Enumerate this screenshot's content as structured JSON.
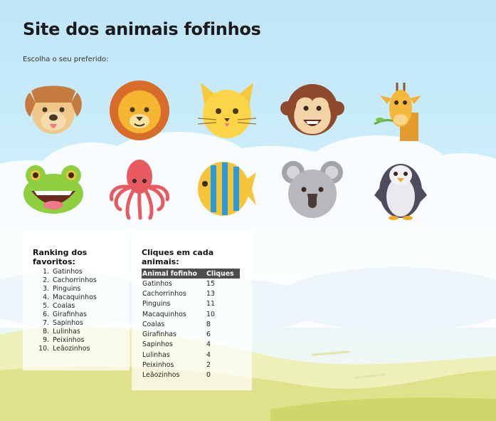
{
  "page": {
    "title": "Site dos animais fofinhos",
    "subtitle": "Escolha o seu preferido:"
  },
  "animals": [
    {
      "name": "dog-icon"
    },
    {
      "name": "lion-icon"
    },
    {
      "name": "cat-icon"
    },
    {
      "name": "monkey-icon"
    },
    {
      "name": "giraffe-icon"
    },
    {
      "name": "frog-icon"
    },
    {
      "name": "octopus-icon"
    },
    {
      "name": "fish-icon"
    },
    {
      "name": "koala-icon"
    },
    {
      "name": "penguin-icon"
    }
  ],
  "ranking": {
    "heading": "Ranking dos favoritos:",
    "items": [
      "Gatinhos",
      "Cachorrinhos",
      "Pinguins",
      "Macaquinhos",
      "Coalas",
      "Girafinhas",
      "Sapinhos",
      "Lulinhas",
      "Peixinhos",
      "Leãozinhos"
    ]
  },
  "clicks": {
    "heading": "Cliques em cada animais:",
    "columns": [
      "Animal fofinho",
      "Cliques"
    ],
    "rows": [
      [
        "Gatinhos",
        "15"
      ],
      [
        "Cachorrinhos",
        "13"
      ],
      [
        "Pinguins",
        "11"
      ],
      [
        "Macaquinhos",
        "10"
      ],
      [
        "Coalas",
        "8"
      ],
      [
        "Girafinhas",
        "6"
      ],
      [
        "Sapinhos",
        "4"
      ],
      [
        "Lulinhas",
        "4"
      ],
      [
        "Peixinhos",
        "2"
      ],
      [
        "Leãozinhos",
        "0"
      ]
    ]
  }
}
